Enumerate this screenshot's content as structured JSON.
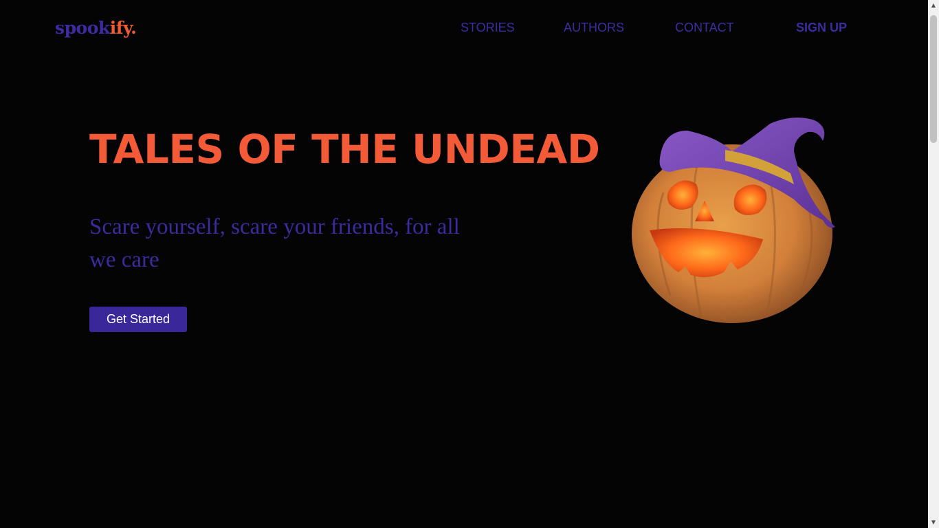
{
  "header": {
    "logo": {
      "part1": "spook",
      "part2": "ify."
    },
    "nav": [
      {
        "label": "STORIES"
      },
      {
        "label": "AUTHORS"
      },
      {
        "label": "CONTACT"
      },
      {
        "label": "SIGN UP"
      }
    ]
  },
  "hero": {
    "title": "TALES OF THE UNDEAD",
    "subtitle": "Scare yourself, scare your friends, for all we care",
    "cta_label": "Get Started"
  },
  "illustration": {
    "name": "pumpkin-witch-hat",
    "colors": {
      "pumpkin": "#d98a3a",
      "glow": "#ff6a1a",
      "hat": "#7a4bb8",
      "hat_band": "#d2a13a"
    }
  },
  "colors": {
    "background": "#050405",
    "accent_orange": "#f35b38",
    "accent_purple": "#3a2c9c"
  }
}
